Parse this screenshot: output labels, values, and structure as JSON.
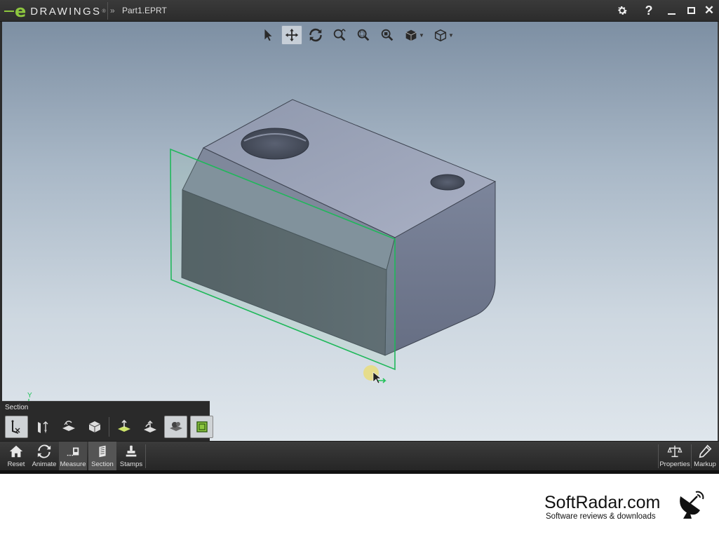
{
  "app": {
    "logo_letter": "e",
    "logo_word": "DRAWINGS",
    "logo_tm": "®",
    "breadcrumb_arrow": "»",
    "document_title": "Part1.EPRT"
  },
  "window_controls": {
    "settings_icon": "gear-icon",
    "help_label": "?",
    "close_label": "✕"
  },
  "view_toolbar": {
    "tools": [
      "select",
      "pan",
      "rotate",
      "zoom",
      "zoom-to-area",
      "zoom-to-fit",
      "display-style",
      "view-orientation"
    ],
    "active_tool": "pan"
  },
  "triad": {
    "axis_label": "Y"
  },
  "section_panel": {
    "title": "Section",
    "tools": [
      "section-plane-x",
      "section-plane-y",
      "section-plane-z",
      "section-box",
      "flip-plane",
      "flip-section",
      "show-cap",
      "show-plane"
    ]
  },
  "bottom_toolbar": {
    "left_items": [
      {
        "label": "Reset",
        "icon": "home-icon"
      },
      {
        "label": "Animate",
        "icon": "animate-icon"
      },
      {
        "label": "Measure",
        "icon": "measure-icon"
      },
      {
        "label": "Section",
        "icon": "section-icon"
      },
      {
        "label": "Stamps",
        "icon": "stamp-icon"
      }
    ],
    "right_items": [
      {
        "label": "Properties",
        "icon": "scale-icon"
      },
      {
        "label": "Markup",
        "icon": "pencil-icon"
      }
    ]
  },
  "watermark": {
    "title": "SoftRadar.com",
    "tagline": "Software reviews & downloads"
  },
  "colors": {
    "accent_green": "#8dc63f",
    "section_plane": "#1fb85a",
    "model_top": "#9fa7bd",
    "model_front": "#4b515c",
    "model_side": "#717a90"
  }
}
